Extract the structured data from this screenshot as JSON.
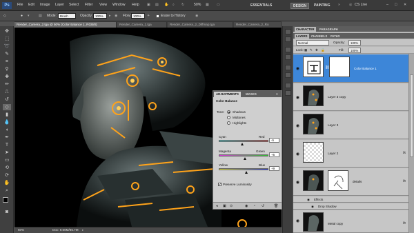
{
  "app": {
    "logo": "Ps",
    "zoom": "50%"
  },
  "menu": [
    "File",
    "Edit",
    "Image",
    "Layer",
    "Select",
    "Filter",
    "View",
    "Window",
    "Help"
  ],
  "workspaces": {
    "essentials": "ESSENTIALS",
    "design": "DESIGN",
    "painting": "PAINTING",
    "cs_live": "CS Live"
  },
  "options": {
    "mode_label": "Mode:",
    "mode_value": "Brush",
    "opacity_label": "Opacity:",
    "opacity_value": "100%",
    "flow_label": "Flow:",
    "flow_value": "100%",
    "erase_history": "Erase to History"
  },
  "doc_tabs": [
    "Render_Camera_2.tga @ 50% (Color Balance 1, RGB/8)",
    "Render_Camera_1.tga",
    "Render_Camera_2_Diffmap.tga",
    "Render_Camera_2_Ro"
  ],
  "status": {
    "zoom": "50%",
    "doc": "Doc: 9.66M/85.7M"
  },
  "adjustments": {
    "tab_active": "ADJUSTMENTS",
    "tab_other": "MASKS",
    "title": "Color Balance",
    "tone_label": "Tone:",
    "tones": [
      "Shadows",
      "Midtones",
      "Highlights"
    ],
    "tone_selected": 0,
    "sliders": [
      {
        "left": "Cyan",
        "right": "Red",
        "value": "-5",
        "position": 0.465,
        "colors": [
          "#2ed8d8",
          "#d83030"
        ]
      },
      {
        "left": "Magenta",
        "right": "Green",
        "value": "+5",
        "position": 0.535,
        "colors": [
          "#d838d8",
          "#30c030"
        ]
      },
      {
        "left": "Yellow",
        "right": "Blue",
        "value": "+9",
        "position": 0.56,
        "colors": [
          "#e0e030",
          "#3040d8"
        ]
      }
    ],
    "preserve": "Preserve Luminosity",
    "preserve_checked": true
  },
  "panels": {
    "top_tabs": [
      "CHARACTER",
      "PARAGRAPH"
    ],
    "layer_tabs": [
      "LAYERS",
      "CHANNELS",
      "PATHS"
    ],
    "blend_mode": "Normal",
    "opacity_label": "Opacity:",
    "opacity_value": "100%",
    "lock_label": "Lock:",
    "fill_label": "Fill:",
    "fill_value": "100%",
    "layers": [
      {
        "name": "Color Balance 1",
        "selected": true,
        "kind": "adjustment"
      },
      {
        "name": "Layer 3 copy",
        "selected": false,
        "kind": "image"
      },
      {
        "name": "Layer 3",
        "selected": false,
        "kind": "image"
      },
      {
        "name": "Layer 2",
        "selected": false,
        "kind": "empty",
        "fx": "fx"
      },
      {
        "name": "details",
        "selected": false,
        "kind": "masked",
        "fx": "fx"
      }
    ],
    "effects_label": "Effects",
    "drop_shadow": "Drop Shadow",
    "last_layer": "Metal copy",
    "last_fx": "fx"
  },
  "colors": {
    "accent_glow": "#ffa31a",
    "selection": "#3d86d8"
  }
}
